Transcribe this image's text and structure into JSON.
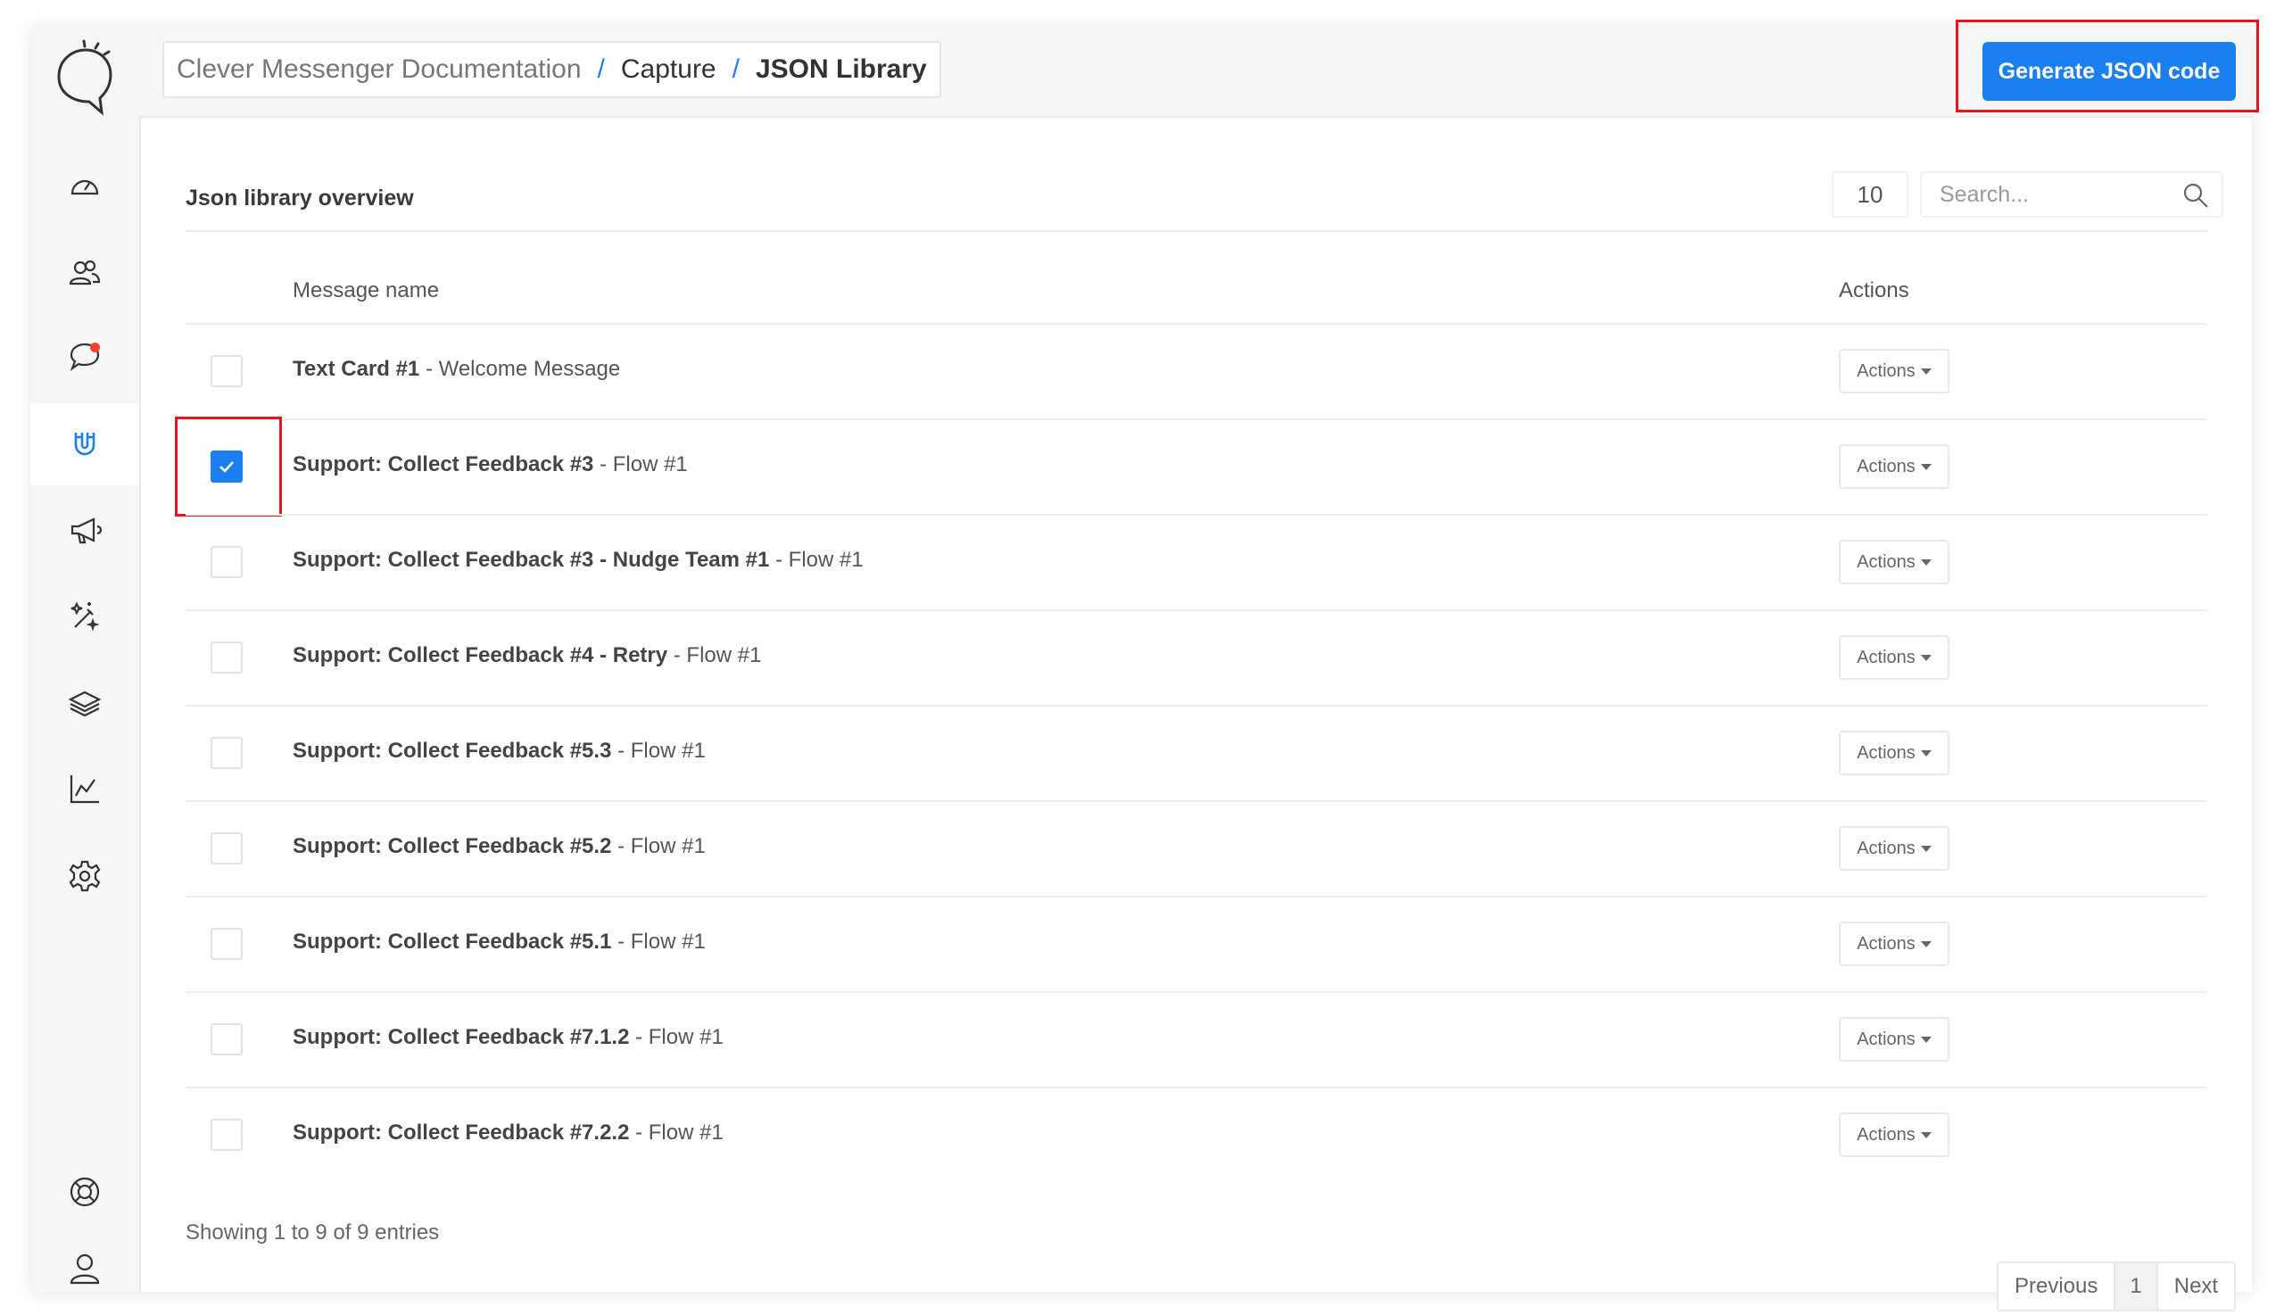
{
  "breadcrumb": {
    "items": [
      "Clever Messenger Documentation",
      "Capture",
      "JSON Library"
    ],
    "separator": "/"
  },
  "header": {
    "generate_button": "Generate JSON code"
  },
  "sidebar": {
    "items": [
      {
        "icon": "dashboard-icon"
      },
      {
        "icon": "users-icon"
      },
      {
        "icon": "chat-icon",
        "notification": true
      },
      {
        "icon": "magnet-icon",
        "active": true
      },
      {
        "icon": "megaphone-icon"
      },
      {
        "icon": "magic-wand-icon"
      },
      {
        "icon": "layers-icon"
      },
      {
        "icon": "analytics-icon"
      },
      {
        "icon": "settings-icon"
      }
    ],
    "bottom": [
      {
        "icon": "help-lifebuoy-icon"
      },
      {
        "icon": "user-profile-icon"
      }
    ]
  },
  "overview": {
    "title": "Json library overview",
    "page_size": "10",
    "search_placeholder": "Search..."
  },
  "table": {
    "columns": [
      "Message name",
      "Actions"
    ],
    "rows": [
      {
        "bold": "Text Card #1",
        "rest": " - Welcome Message",
        "checked": false,
        "action": "Actions"
      },
      {
        "bold": "Support: Collect Feedback #3",
        "rest": " - Flow #1",
        "checked": true,
        "action": "Actions"
      },
      {
        "bold": "Support: Collect Feedback #3 - Nudge Team #1",
        "rest": " - Flow #1",
        "checked": false,
        "action": "Actions"
      },
      {
        "bold": "Support: Collect Feedback #4 - Retry",
        "rest": " - Flow #1",
        "checked": false,
        "action": "Actions"
      },
      {
        "bold": "Support: Collect Feedback #5.3",
        "rest": " - Flow #1",
        "checked": false,
        "action": "Actions"
      },
      {
        "bold": "Support: Collect Feedback #5.2",
        "rest": " - Flow #1",
        "checked": false,
        "action": "Actions"
      },
      {
        "bold": "Support: Collect Feedback #5.1",
        "rest": " - Flow #1",
        "checked": false,
        "action": "Actions"
      },
      {
        "bold": "Support: Collect Feedback #7.1.2",
        "rest": " - Flow #1",
        "checked": false,
        "action": "Actions"
      },
      {
        "bold": "Support: Collect Feedback #7.2.2",
        "rest": " - Flow #1",
        "checked": false,
        "action": "Actions"
      }
    ]
  },
  "footer": {
    "info": "Showing 1 to 9 of 9 entries",
    "pagination": {
      "previous": "Previous",
      "current": "1",
      "next": "Next"
    }
  },
  "colors": {
    "accent": "#1a7ff0",
    "highlight": "#e8141c",
    "notification": "#f4442e"
  }
}
